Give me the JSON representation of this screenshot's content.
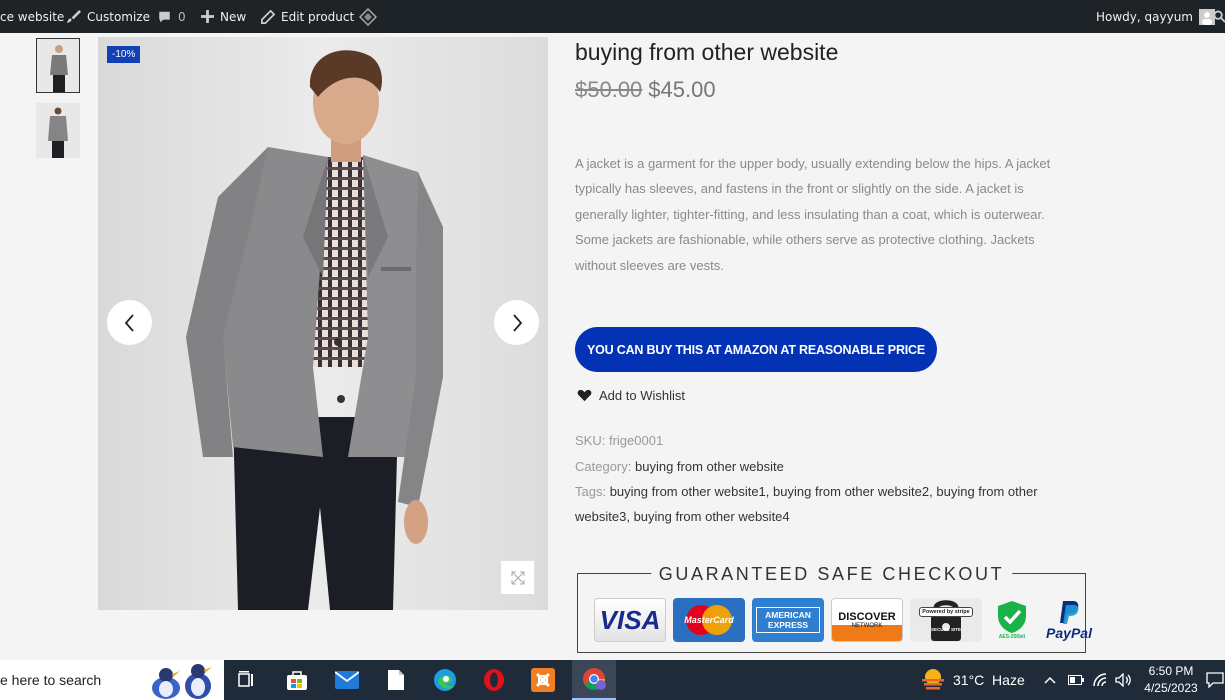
{
  "adminbar": {
    "site_name": "ce website",
    "customize": "Customize",
    "comments_count": "0",
    "new_label": "New",
    "edit_label": "Edit product",
    "howdy": "Howdy, qayyum"
  },
  "product": {
    "badge": "-10%",
    "title": "buying from other website",
    "old_price": "$50.00",
    "new_price": "$45.00",
    "description": "A jacket is a garment for the upper body, usually extending below the hips. A jacket typically has sleeves, and fastens in the front or slightly on the side. A jacket is generally lighter, tighter-fitting, and less insulating than a coat, which is outerwear. Some jackets are fashionable, while others serve as protective clothing. Jackets without sleeves are vests.",
    "buy_button": "YOU CAN BUY THIS AT AMAZON AT REASONABLE PRICE",
    "wishlist": "Add to Wishlist",
    "sku_label": "SKU:",
    "sku_value": "frige0001",
    "category_label": "Category:",
    "category_value": "buying from other website",
    "tags_label": "Tags:",
    "tags": [
      "buying from other website1",
      "buying from other website2",
      "buying from other website3",
      "buying from other website4"
    ]
  },
  "checkout": {
    "heading": "GUARANTEED SAFE CHECKOUT",
    "logos": [
      "VISA",
      "MasterCard",
      "AMERICAN EXPRESS",
      "DISCOVER",
      "Powered by stripe",
      "AES-256bit",
      "PayPal"
    ],
    "sub": {
      "discover": "NETWORK",
      "stripe": "SECURE SITE"
    }
  },
  "taskbar": {
    "search_placeholder": "e here to search",
    "weather": "31°C  Haze",
    "time": "6:50 PM",
    "date": "4/25/2023"
  },
  "colors": {
    "accent": "#0432b5",
    "badge": "#1340b4",
    "adminbar": "#1d2327",
    "taskbar": "#202b3a"
  }
}
